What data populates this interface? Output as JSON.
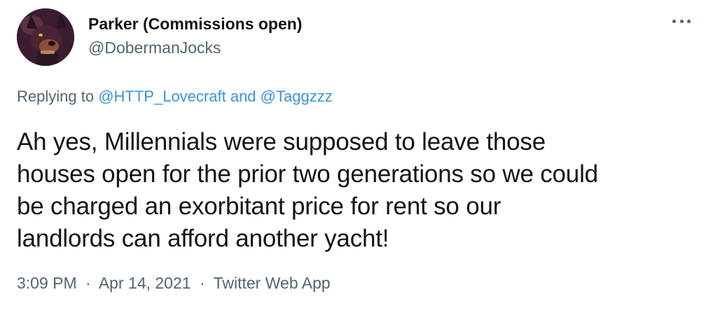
{
  "author": {
    "display_name": "Parker (Commissions open)",
    "handle": "@DobermanJocks",
    "avatar_icon": "doberman-avatar-icon"
  },
  "more_icon": "more-options-icon",
  "reply_context": {
    "prefix": "Replying to",
    "mention_1": "@HTTP_Lovecraft",
    "joiner": "and",
    "mention_2": "@Taggzzz"
  },
  "tweet": {
    "lines": [
      "Ah yes, Millennials were supposed to leave those",
      "houses open for the prior two generations so we could",
      "be charged an exorbitant price for rent so our",
      "landlords can afford another yacht!"
    ]
  },
  "meta": {
    "time": "3:09 PM",
    "separator": "·",
    "date": "Apr 14, 2021",
    "source": "Twitter Web App"
  },
  "colors": {
    "text": "#0f1419",
    "secondary": "#536471",
    "link": "#3b94d9"
  }
}
